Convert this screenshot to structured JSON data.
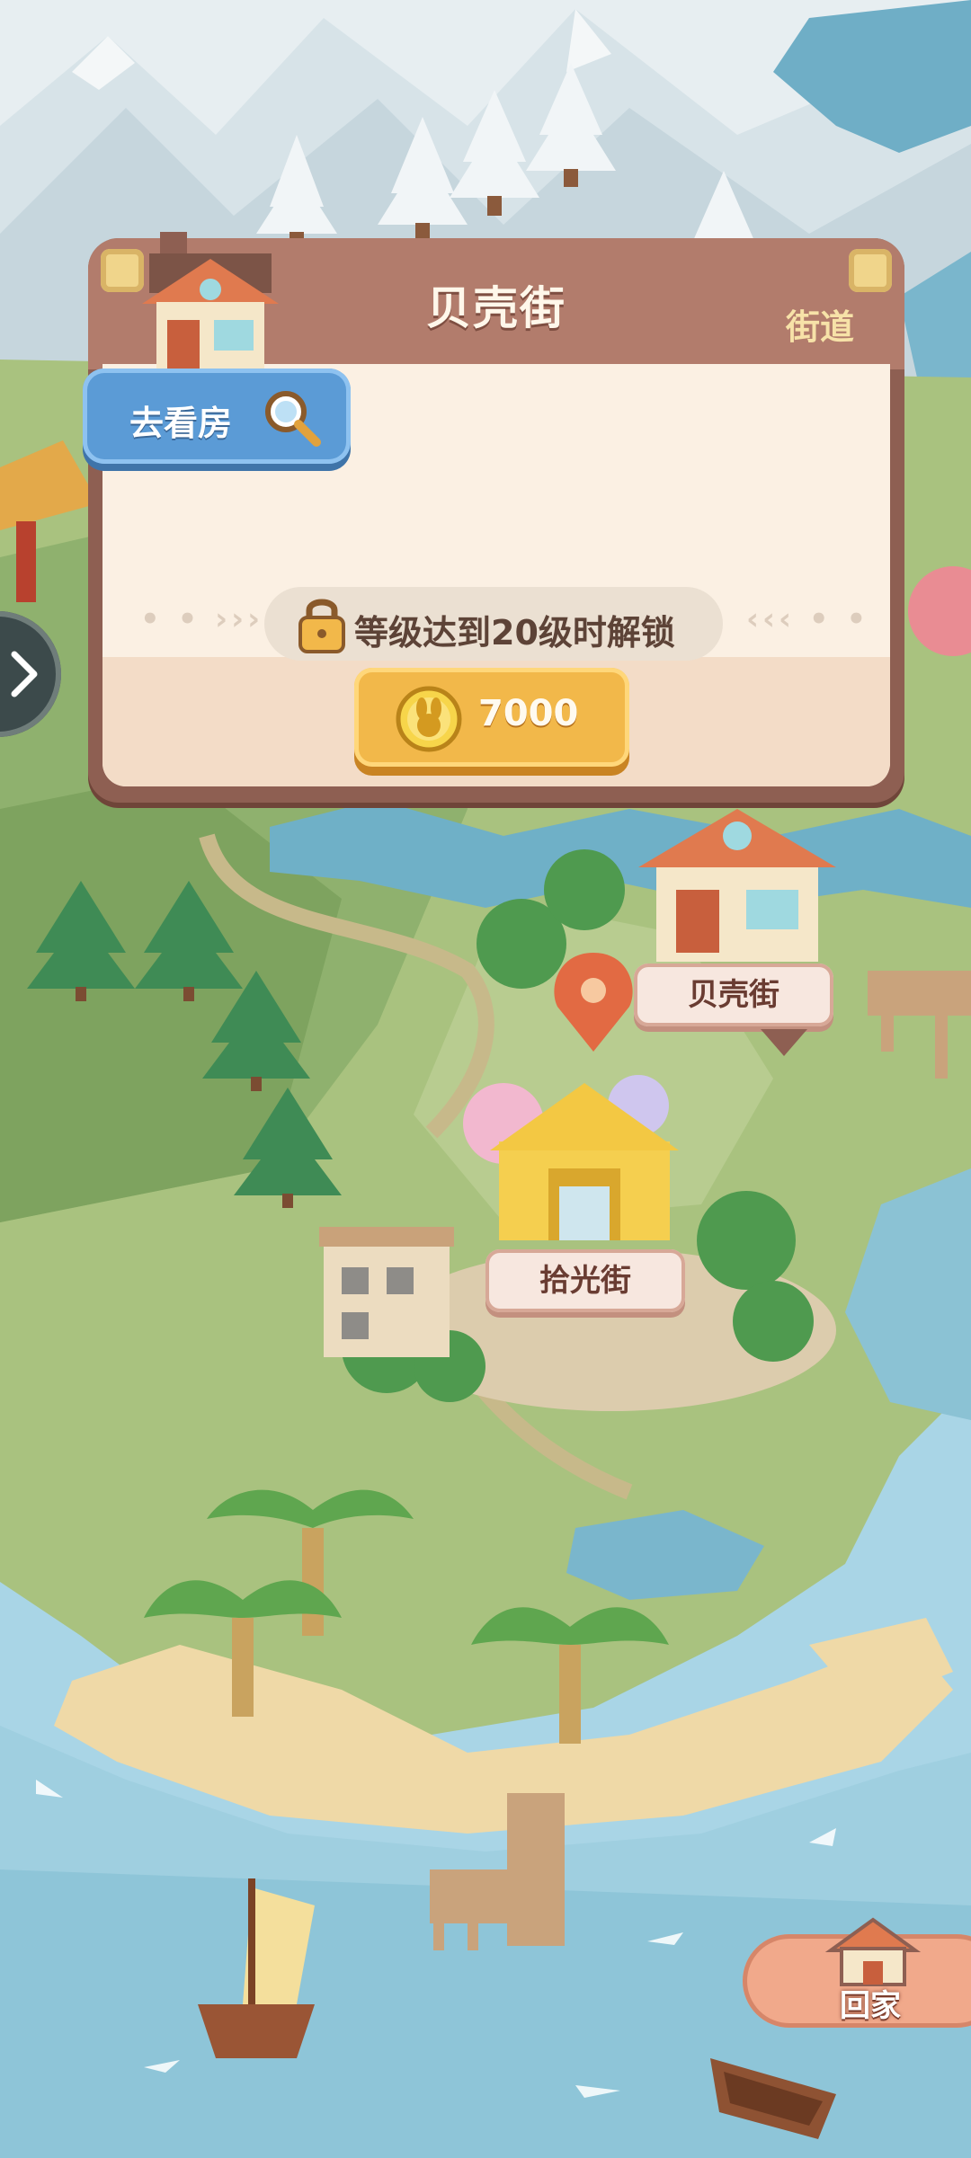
{
  "popup": {
    "title": "贝壳街",
    "tag": "街道",
    "view_house_label": "去看房",
    "lock_text": "等级达到20级时解锁",
    "cost": "7000"
  },
  "map": {
    "labels": {
      "shell_street": "贝壳街",
      "shiguang_street": "拾光街"
    }
  },
  "home_button": {
    "label": "回家"
  },
  "colors": {
    "panel_header": "#b27c6c",
    "panel_frame": "#8e5f52",
    "panel_body": "#fbf0e3",
    "gold_button": "#f2b84a",
    "blue_button": "#5b9bd6",
    "grass": "#b4c78a",
    "sea": "#9fcfe0",
    "sand": "#efd9a7"
  },
  "icons": {
    "search": "search-icon",
    "lock": "lock-icon",
    "coin": "rabbit-coin-icon",
    "location": "location-pin-icon",
    "arrow": "chevron-right-icon",
    "home": "house-icon"
  }
}
